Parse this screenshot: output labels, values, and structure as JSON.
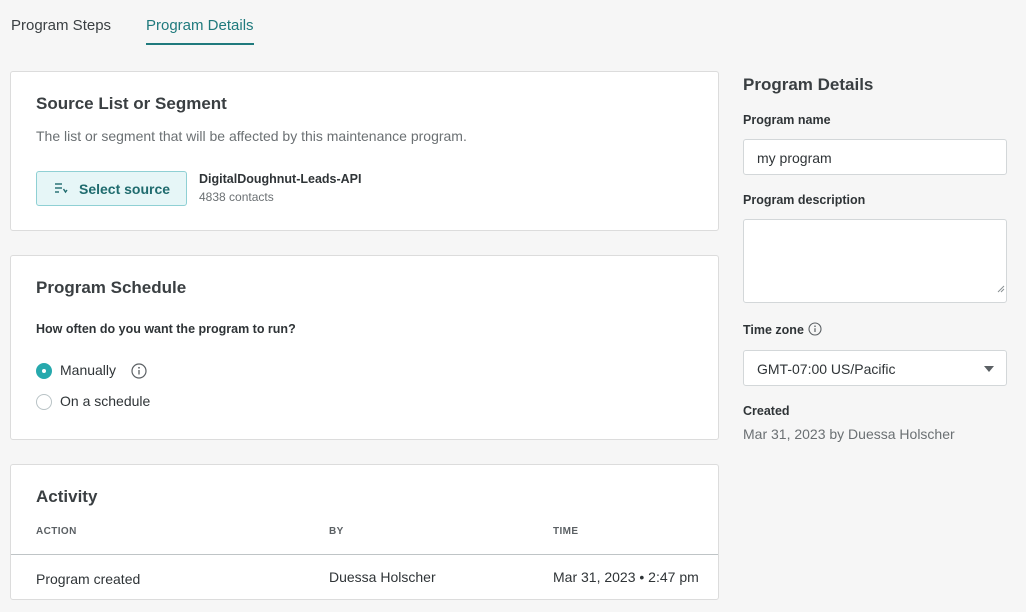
{
  "tabs": [
    {
      "label": "Program Steps",
      "active": false
    },
    {
      "label": "Program Details",
      "active": true
    }
  ],
  "accent_color": "#1f7a7d",
  "source": {
    "title": "Source List or Segment",
    "description": "The list or segment that will be affected by this maintenance program.",
    "button_label": "Select source",
    "button_icon": "list-filter-icon",
    "selected_name": "DigitalDoughnut-Leads-API",
    "selected_count": "4838 contacts"
  },
  "schedule": {
    "title": "Program Schedule",
    "question": "How often do you want the program to run?",
    "options": [
      {
        "label": "Manually",
        "checked": true
      },
      {
        "label": "On a schedule",
        "checked": false
      }
    ]
  },
  "activity": {
    "title": "Activity",
    "columns": [
      "ACTION",
      "BY",
      "TIME"
    ],
    "rows": [
      {
        "action": "Program created",
        "by": "Duessa Holscher",
        "time": "Mar 31, 2023 • 2:47 pm"
      }
    ]
  },
  "details": {
    "title": "Program Details",
    "name_label": "Program name",
    "name_value": "my program",
    "description_label": "Program description",
    "description_value": "",
    "timezone_label": "Time zone",
    "timezone_value": "GMT-07:00 US/Pacific",
    "created_label": "Created",
    "created_value": "Mar 31, 2023 by Duessa Holscher"
  }
}
